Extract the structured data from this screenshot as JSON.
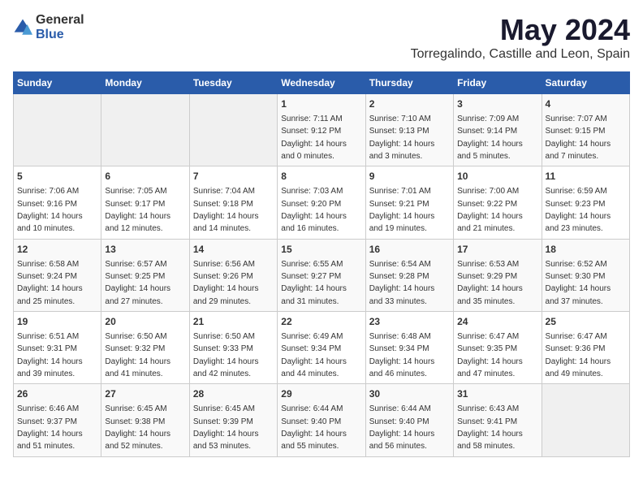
{
  "logo": {
    "text_general": "General",
    "text_blue": "Blue"
  },
  "title": "May 2024",
  "subtitle": "Torregalindo, Castille and Leon, Spain",
  "days_of_week": [
    "Sunday",
    "Monday",
    "Tuesday",
    "Wednesday",
    "Thursday",
    "Friday",
    "Saturday"
  ],
  "weeks": [
    [
      {
        "day": "",
        "info": ""
      },
      {
        "day": "",
        "info": ""
      },
      {
        "day": "",
        "info": ""
      },
      {
        "day": "1",
        "info": "Sunrise: 7:11 AM\nSunset: 9:12 PM\nDaylight: 14 hours\nand 0 minutes."
      },
      {
        "day": "2",
        "info": "Sunrise: 7:10 AM\nSunset: 9:13 PM\nDaylight: 14 hours\nand 3 minutes."
      },
      {
        "day": "3",
        "info": "Sunrise: 7:09 AM\nSunset: 9:14 PM\nDaylight: 14 hours\nand 5 minutes."
      },
      {
        "day": "4",
        "info": "Sunrise: 7:07 AM\nSunset: 9:15 PM\nDaylight: 14 hours\nand 7 minutes."
      }
    ],
    [
      {
        "day": "5",
        "info": "Sunrise: 7:06 AM\nSunset: 9:16 PM\nDaylight: 14 hours\nand 10 minutes."
      },
      {
        "day": "6",
        "info": "Sunrise: 7:05 AM\nSunset: 9:17 PM\nDaylight: 14 hours\nand 12 minutes."
      },
      {
        "day": "7",
        "info": "Sunrise: 7:04 AM\nSunset: 9:18 PM\nDaylight: 14 hours\nand 14 minutes."
      },
      {
        "day": "8",
        "info": "Sunrise: 7:03 AM\nSunset: 9:20 PM\nDaylight: 14 hours\nand 16 minutes."
      },
      {
        "day": "9",
        "info": "Sunrise: 7:01 AM\nSunset: 9:21 PM\nDaylight: 14 hours\nand 19 minutes."
      },
      {
        "day": "10",
        "info": "Sunrise: 7:00 AM\nSunset: 9:22 PM\nDaylight: 14 hours\nand 21 minutes."
      },
      {
        "day": "11",
        "info": "Sunrise: 6:59 AM\nSunset: 9:23 PM\nDaylight: 14 hours\nand 23 minutes."
      }
    ],
    [
      {
        "day": "12",
        "info": "Sunrise: 6:58 AM\nSunset: 9:24 PM\nDaylight: 14 hours\nand 25 minutes."
      },
      {
        "day": "13",
        "info": "Sunrise: 6:57 AM\nSunset: 9:25 PM\nDaylight: 14 hours\nand 27 minutes."
      },
      {
        "day": "14",
        "info": "Sunrise: 6:56 AM\nSunset: 9:26 PM\nDaylight: 14 hours\nand 29 minutes."
      },
      {
        "day": "15",
        "info": "Sunrise: 6:55 AM\nSunset: 9:27 PM\nDaylight: 14 hours\nand 31 minutes."
      },
      {
        "day": "16",
        "info": "Sunrise: 6:54 AM\nSunset: 9:28 PM\nDaylight: 14 hours\nand 33 minutes."
      },
      {
        "day": "17",
        "info": "Sunrise: 6:53 AM\nSunset: 9:29 PM\nDaylight: 14 hours\nand 35 minutes."
      },
      {
        "day": "18",
        "info": "Sunrise: 6:52 AM\nSunset: 9:30 PM\nDaylight: 14 hours\nand 37 minutes."
      }
    ],
    [
      {
        "day": "19",
        "info": "Sunrise: 6:51 AM\nSunset: 9:31 PM\nDaylight: 14 hours\nand 39 minutes."
      },
      {
        "day": "20",
        "info": "Sunrise: 6:50 AM\nSunset: 9:32 PM\nDaylight: 14 hours\nand 41 minutes."
      },
      {
        "day": "21",
        "info": "Sunrise: 6:50 AM\nSunset: 9:33 PM\nDaylight: 14 hours\nand 42 minutes."
      },
      {
        "day": "22",
        "info": "Sunrise: 6:49 AM\nSunset: 9:34 PM\nDaylight: 14 hours\nand 44 minutes."
      },
      {
        "day": "23",
        "info": "Sunrise: 6:48 AM\nSunset: 9:34 PM\nDaylight: 14 hours\nand 46 minutes."
      },
      {
        "day": "24",
        "info": "Sunrise: 6:47 AM\nSunset: 9:35 PM\nDaylight: 14 hours\nand 47 minutes."
      },
      {
        "day": "25",
        "info": "Sunrise: 6:47 AM\nSunset: 9:36 PM\nDaylight: 14 hours\nand 49 minutes."
      }
    ],
    [
      {
        "day": "26",
        "info": "Sunrise: 6:46 AM\nSunset: 9:37 PM\nDaylight: 14 hours\nand 51 minutes."
      },
      {
        "day": "27",
        "info": "Sunrise: 6:45 AM\nSunset: 9:38 PM\nDaylight: 14 hours\nand 52 minutes."
      },
      {
        "day": "28",
        "info": "Sunrise: 6:45 AM\nSunset: 9:39 PM\nDaylight: 14 hours\nand 53 minutes."
      },
      {
        "day": "29",
        "info": "Sunrise: 6:44 AM\nSunset: 9:40 PM\nDaylight: 14 hours\nand 55 minutes."
      },
      {
        "day": "30",
        "info": "Sunrise: 6:44 AM\nSunset: 9:40 PM\nDaylight: 14 hours\nand 56 minutes."
      },
      {
        "day": "31",
        "info": "Sunrise: 6:43 AM\nSunset: 9:41 PM\nDaylight: 14 hours\nand 58 minutes."
      },
      {
        "day": "",
        "info": ""
      }
    ]
  ]
}
